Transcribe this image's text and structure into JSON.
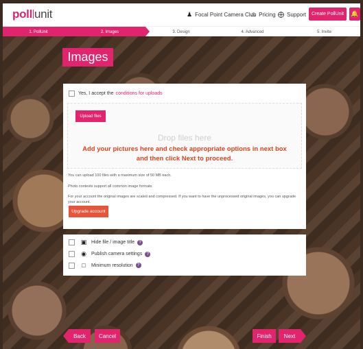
{
  "brand": {
    "logo_main": "poll",
    "logo_sub": "unit"
  },
  "header": {
    "account": "Focal Point Camera Club",
    "pricing": "Pricing",
    "support": "Support",
    "create_button": "Create PollUnit"
  },
  "steps": [
    {
      "label": "1. PollUnit"
    },
    {
      "label": "2. Images"
    },
    {
      "label": "3. Design"
    },
    {
      "label": "4. Advanced"
    },
    {
      "label": "5. Invite"
    }
  ],
  "page": {
    "title": "Images"
  },
  "upload": {
    "accept_prefix": "Yes, I accept the",
    "accept_link": "conditions for uploads",
    "upload_button": "Upload files",
    "drop_text": "Drop files here",
    "overlay_line1": "Add your pictures here and check appropriate options in next box",
    "overlay_line2": "and then click Next to proceed.",
    "info_limit": "You can upload 100 files with a maximum size of 50 MB each.",
    "info_formats": "Photo contests support all common image formats.",
    "info_account": "For your account the original images are scaled and compressed. If you want to have the unprocessed original images, you can upgrade your account.",
    "upgrade_button": "Upgrade account"
  },
  "options": [
    {
      "label": "Hide file / image title",
      "icon": "image-icon"
    },
    {
      "label": "Publish camera settings",
      "icon": "camera-icon"
    },
    {
      "label": "Minimum resolution",
      "icon": "resolution-icon"
    }
  ],
  "footer": {
    "back": "Back",
    "cancel": "Cancel",
    "finish": "Finish",
    "next": "Next"
  },
  "colors": {
    "accent": "#e2246f",
    "overlay_text": "#e8401a",
    "help_badge": "#7b4e8e"
  }
}
